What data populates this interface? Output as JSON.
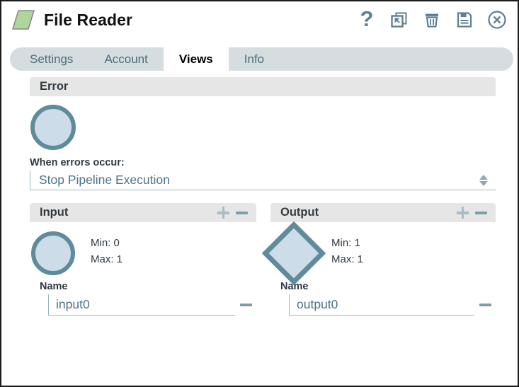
{
  "window": {
    "title": "File Reader",
    "node_icon": "parallelogram-node-icon",
    "node_icon_color": "#aed59a",
    "node_icon_border": "#8a8a8a"
  },
  "titlebar_icons": [
    {
      "name": "help-icon",
      "glyph": "?"
    },
    {
      "name": "duplicate-icon",
      "glyph": ""
    },
    {
      "name": "delete-icon",
      "glyph": ""
    },
    {
      "name": "save-icon",
      "glyph": ""
    },
    {
      "name": "close-icon",
      "glyph": ""
    }
  ],
  "tabs": [
    {
      "label": "Settings",
      "active": false
    },
    {
      "label": "Account",
      "active": false
    },
    {
      "label": "Views",
      "active": true
    },
    {
      "label": "Info",
      "active": false
    }
  ],
  "error_section": {
    "title": "Error",
    "port_shape": "circle",
    "field_label": "When errors occur:",
    "selected_option": "Stop Pipeline Execution"
  },
  "input_section": {
    "title": "Input",
    "add_label": "+",
    "remove_label": "-",
    "port": {
      "shape": "circle",
      "min_label": "Min: 0",
      "max_label": "Max: 1",
      "name_label": "Name",
      "name_value": "input0"
    }
  },
  "output_section": {
    "title": "Output",
    "add_label": "+",
    "remove_label": "-",
    "port": {
      "shape": "diamond",
      "min_label": "Min: 1",
      "max_label": "Max: 1",
      "name_label": "Name",
      "name_value": "output0"
    }
  },
  "colors": {
    "accent_slate": "#5f8b9b",
    "port_fill": "#ccdce8",
    "header_grey": "#e6e6e6",
    "tabbar_grey": "#d6dde0",
    "field_border": "#9fb6c0",
    "value_text": "#4d7489"
  }
}
